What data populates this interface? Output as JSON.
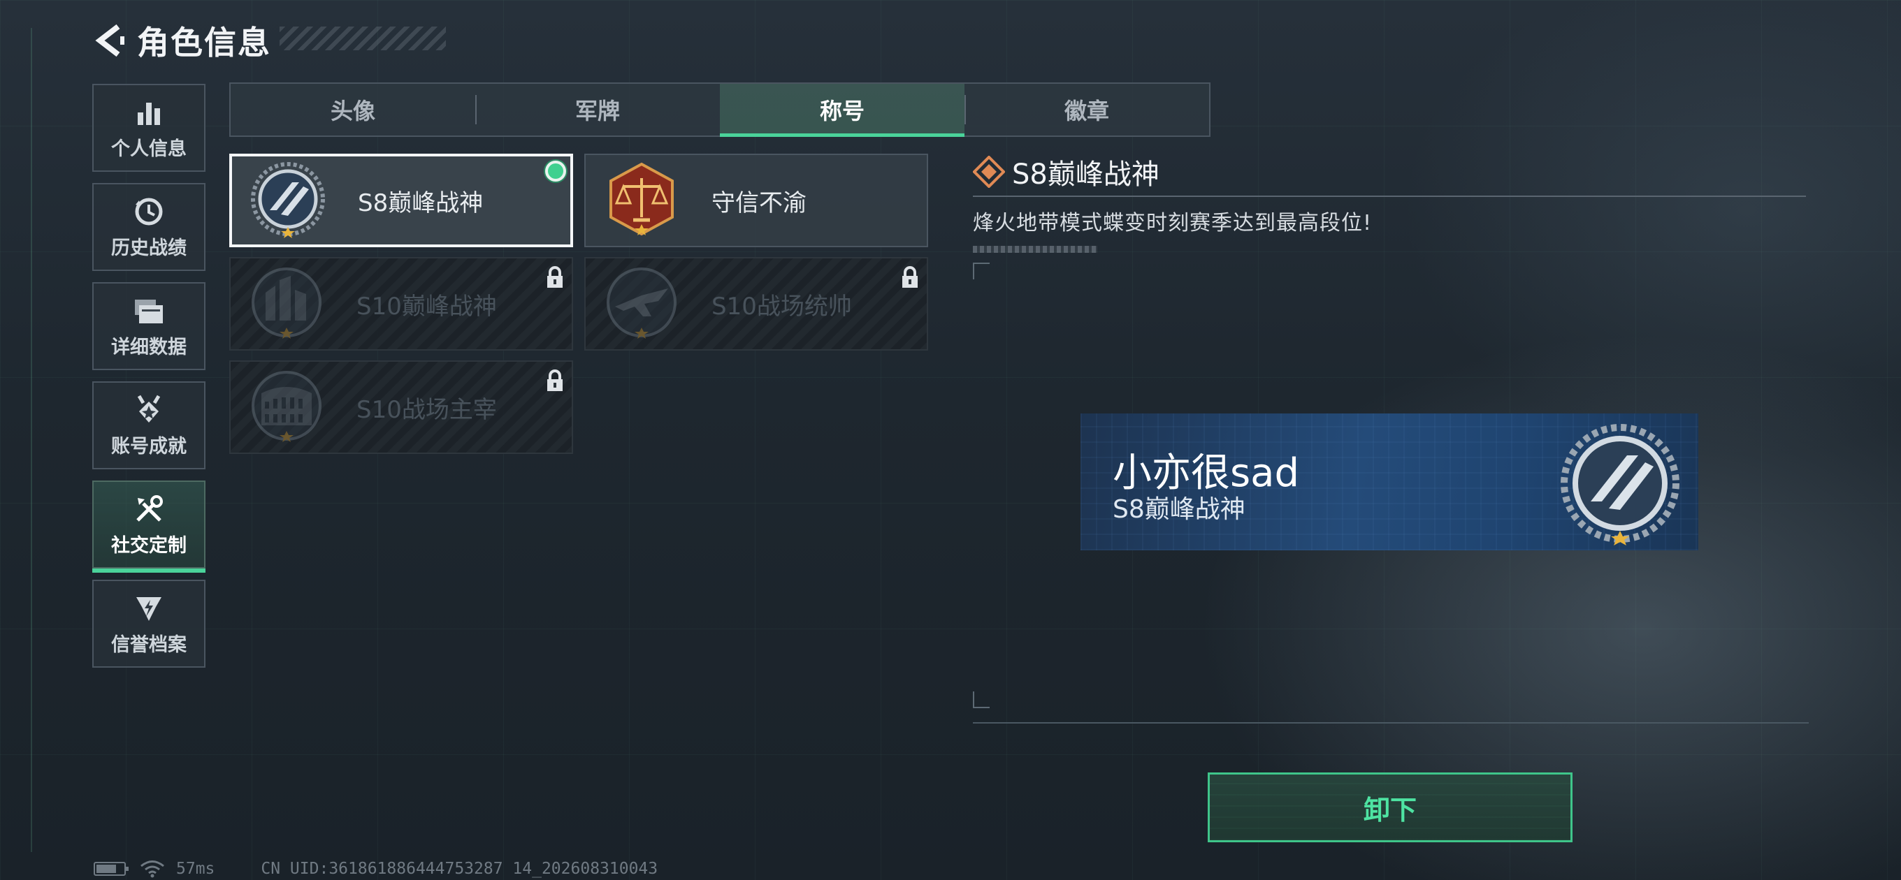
{
  "header": {
    "title": "角色信息"
  },
  "sidebar": {
    "items": [
      {
        "label": "个人信息",
        "icon": "bar-chart-icon",
        "active": false
      },
      {
        "label": "历史战绩",
        "icon": "history-clock-icon",
        "active": false
      },
      {
        "label": "详细数据",
        "icon": "folders-icon",
        "active": false
      },
      {
        "label": "账号成就",
        "icon": "achievement-medal-icon",
        "active": false
      },
      {
        "label": "社交定制",
        "icon": "tools-icon",
        "active": true
      },
      {
        "label": "信誉档案",
        "icon": "credit-shield-icon",
        "active": false
      }
    ]
  },
  "tabs": [
    {
      "label": "头像",
      "active": false
    },
    {
      "label": "军牌",
      "active": false
    },
    {
      "label": "称号",
      "active": true
    },
    {
      "label": "徽章",
      "active": false
    }
  ],
  "titles": [
    {
      "name": "S8巅峰战神",
      "state": "equipped",
      "emblem": "shield-stripes-emblem"
    },
    {
      "name": "守信不渝",
      "state": "unlocked",
      "emblem": "scales-of-justice-emblem"
    },
    {
      "name": "S10巅峰战神",
      "state": "locked",
      "emblem": "ruins-emblem"
    },
    {
      "name": "S10战场统帅",
      "state": "locked",
      "emblem": "fighter-jet-emblem"
    },
    {
      "name": "S10战场主宰",
      "state": "locked",
      "emblem": "colosseum-emblem"
    }
  ],
  "detail": {
    "title": "S8巅峰战神",
    "description": "烽火地带模式蝶变时刻赛季达到最高段位!"
  },
  "nameplate": {
    "player_name": "小亦很sad",
    "title": "S8巅峰战神"
  },
  "actions": {
    "unequip_label": "卸下"
  },
  "status_bar": {
    "ping": "57ms",
    "uid": "CN UID:361861886444753287 14_202608310043"
  },
  "colors": {
    "accent": "#4ad39a",
    "background": "#1e272f",
    "nameplate": "#244b79"
  }
}
